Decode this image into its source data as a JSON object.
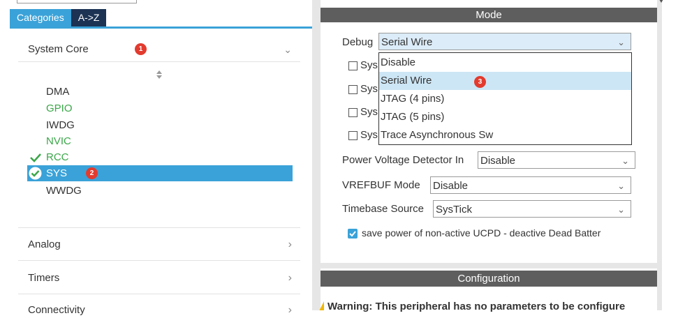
{
  "left_panel": {
    "tabs": [
      {
        "label": "Categories",
        "active": true
      },
      {
        "label": "A->Z",
        "active": false
      }
    ],
    "category_system_core": "System Core",
    "sort_icon": "sort-updown-icon",
    "peripherals": [
      {
        "label": "DMA",
        "color": "#333333",
        "status": "none"
      },
      {
        "label": "GPIO",
        "color": "#3aa648",
        "status": "none"
      },
      {
        "label": "IWDG",
        "color": "#333333",
        "status": "none"
      },
      {
        "label": "NVIC",
        "color": "#3aa648",
        "status": "none"
      },
      {
        "label": "RCC",
        "color": "#3aa648",
        "status": "check"
      },
      {
        "label": "SYS",
        "color": "#ffffff",
        "status": "check-circle",
        "selected": true
      },
      {
        "label": "WWDG",
        "color": "#333333",
        "status": "none"
      }
    ],
    "categories": [
      "Analog",
      "Timers",
      "Connectivity"
    ]
  },
  "badges": [
    "1",
    "2",
    "3"
  ],
  "mode": {
    "header": "Mode",
    "debug_label": "Debug",
    "debug_value": "Serial Wire",
    "sys_checkboxes": [
      "Sys",
      "Sys",
      "Sys",
      "Sys"
    ],
    "debug_options": [
      "Disable",
      "Serial Wire",
      "JTAG (4 pins)",
      "JTAG (5 pins)",
      "Trace Asynchronous Sw"
    ],
    "highlighted_option": "Serial Wire",
    "pvd_label": "Power Voltage Detector In",
    "pvd_value": "Disable",
    "vrefbuf_label": "VREFBUF Mode",
    "vrefbuf_value": "Disable",
    "timebase_label": "Timebase Source",
    "timebase_value": "SysTick",
    "ucpd_label": "save power of non-active UCPD - deactive Dead Batter",
    "ucpd_checked": true
  },
  "configuration": {
    "header": "Configuration",
    "warning": "Warning: This peripheral has no parameters to be configure"
  },
  "colors": {
    "accent": "#3aa2d8",
    "tab_dark": "#1c3354",
    "header_gray": "#5e5e5e",
    "badge_red": "#e23b2e",
    "green": "#3aa648"
  }
}
